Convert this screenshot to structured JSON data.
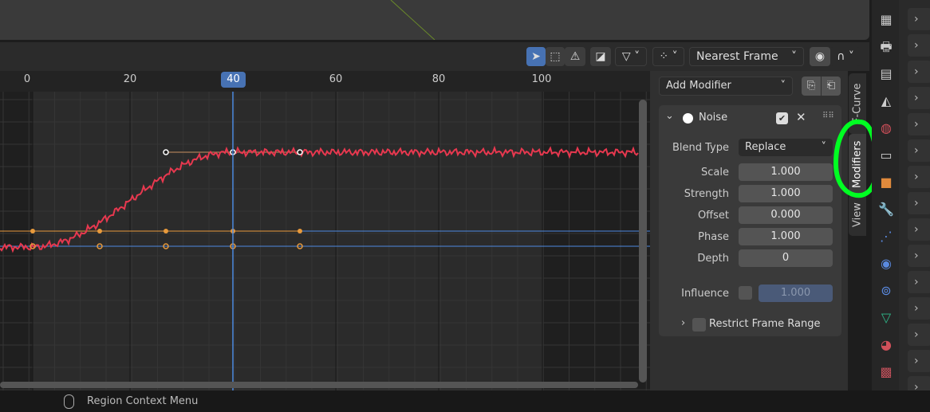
{
  "header": {
    "interpolation_mode": "Nearest Frame"
  },
  "timeline": {
    "ticks": [
      "0",
      "20",
      "40",
      "60",
      "80",
      "100"
    ],
    "tick_frames": [
      0,
      20,
      40,
      60,
      80,
      100
    ],
    "current_frame": "40",
    "current_frame_value": 40
  },
  "sidebar": {
    "add_modifier": "Add Modifier",
    "modifier": {
      "name": "Noise",
      "enabled": true,
      "fields": [
        {
          "label": "Blend Type",
          "value": "Replace",
          "dropdown": true
        },
        {
          "label": "Scale",
          "value": "1.000"
        },
        {
          "label": "Strength",
          "value": "1.000"
        },
        {
          "label": "Offset",
          "value": "0.000"
        },
        {
          "label": "Phase",
          "value": "1.000"
        },
        {
          "label": "Depth",
          "value": "0"
        }
      ],
      "influence_label": "Influence",
      "influence_value": "1.000",
      "influence_enabled": false,
      "restrict_label": "Restrict Frame Range"
    }
  },
  "tabs": [
    "F-Curve",
    "Modifiers",
    "View"
  ],
  "active_tab": "Modifiers",
  "property_icons": [
    "render-icon",
    "output-icon",
    "view-layer-icon",
    "scene-icon",
    "world-icon",
    "collection-icon",
    "object-icon",
    "modifier-wrench-icon",
    "particles-icon",
    "physics-icon",
    "constraints-icon",
    "data-mesh-icon",
    "material-icon",
    "texture-icon"
  ],
  "status": {
    "text": "Region Context Menu"
  },
  "colors": {
    "accent": "#4772b3",
    "curve": "#e8384f",
    "annotation": "#00ff22",
    "orange": "#e89a3c",
    "blue_line": "#4d8ae0"
  }
}
